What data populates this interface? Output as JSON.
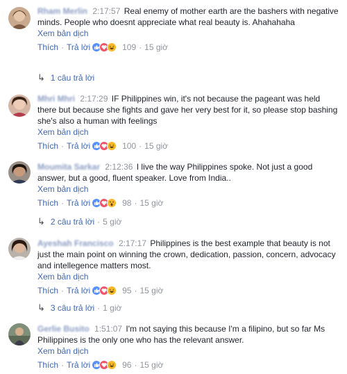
{
  "comments": [
    {
      "name": "Rham Merlin",
      "time": "2:17:57",
      "text": "Real enemy of mother earth are the bashers with negative minds. People who doesnt appreciate what real beauty is. Ahahahaha",
      "translate": "Xem bản dịch",
      "like": "Thích",
      "reply": "Trả lời",
      "reactions": [
        "like",
        "love",
        "haha"
      ],
      "count": "109",
      "age": "15 giờ",
      "replies": {
        "text": "1 câu trả lời",
        "age": ""
      }
    },
    {
      "name": "Mhri Mhri",
      "time": "2:17:29",
      "text": "IF Philippines win, it's not because the pageant was held there but because she fights and gave her very best for it, so please stop bashing she's also a human with feelings",
      "translate": "Xem bản dịch",
      "like": "Thích",
      "reply": "Trả lời",
      "reactions": [
        "like",
        "love",
        "haha"
      ],
      "count": "100",
      "age": "15 giờ"
    },
    {
      "name": "Moumita Sarkar",
      "time": "2:12:36",
      "text": "I live the way Philippines spoke. Not just a good answer, but a good, fluent speaker. Love from India..",
      "translate": "Xem bản dịch",
      "like": "Thích",
      "reply": "Trả lời",
      "reactions": [
        "like",
        "love",
        "wow"
      ],
      "count": "98",
      "age": "15 giờ",
      "replies": {
        "text": "2 câu trả lời",
        "age": "5 giờ"
      }
    },
    {
      "name": "Ayeshah Francisco",
      "time": "2:17:17",
      "text": "Philippines is the best example that beauty is not just the main point on winning the crown, dedication, passion, concern, advocacy and intellegence matters most.",
      "translate": "Xem bản dịch",
      "like": "Thích",
      "reply": "Trả lời",
      "reactions": [
        "like",
        "love",
        "haha"
      ],
      "count": "95",
      "age": "15 giờ",
      "replies": {
        "text": "3 câu trả lời",
        "age": "1 giờ"
      }
    },
    {
      "name": "Gerlie Busito",
      "time": "1:51:07",
      "text": "I'm not saying this because I'm a filipino, but so far Ms Philippines is the only one who has the relevant answer.",
      "translate": "Xem bản dịch",
      "like": "Thích",
      "reply": "Trả lời",
      "reactions": [
        "like",
        "love",
        "haha"
      ],
      "count": "96",
      "age": "15 giờ"
    }
  ],
  "separator": "·",
  "colors": {
    "link": "#4267b2",
    "meta": "#90949c",
    "text": "#1d2129",
    "like": "#5890ff",
    "love": "#f25268",
    "haha": "#f7b928"
  }
}
